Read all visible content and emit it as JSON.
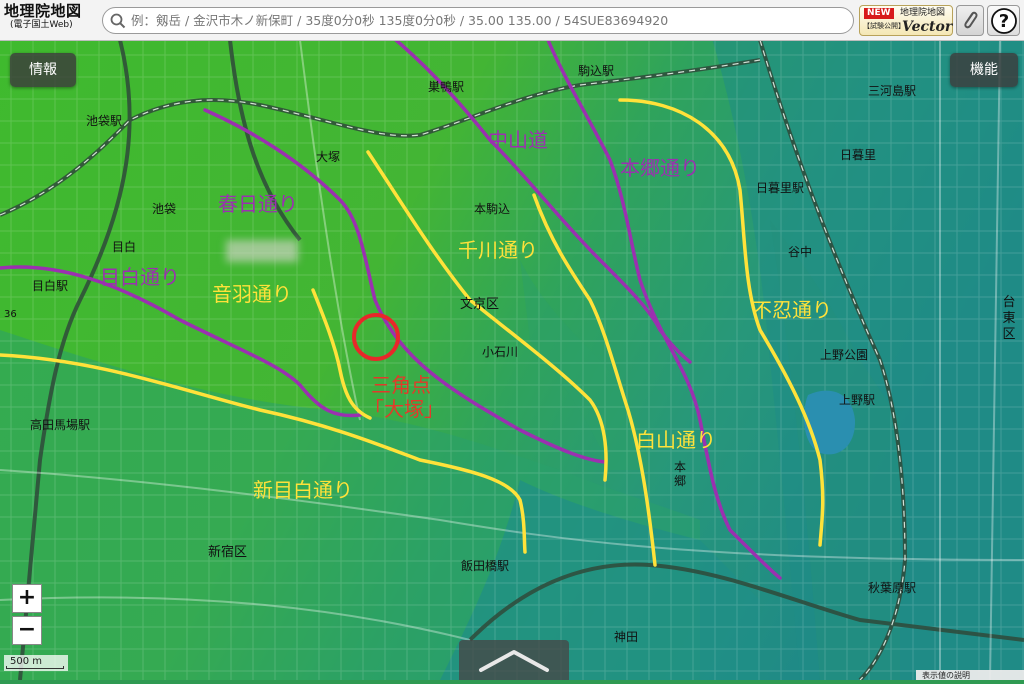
{
  "header": {
    "logo_title": "地理院地図",
    "logo_subtitle": "(電子国土Web)",
    "search_placeholder": "例：剱岳 / 金沢市木ノ新保町 / 35度0分0秒 135度0分0秒 / 35.00 135.00 / 54SUE83694920",
    "vector_badge_new": "NEW",
    "vector_badge_trial": "【試験公開】",
    "vector_badge_title": "地理院地図",
    "vector_badge_en": "Vector"
  },
  "buttons": {
    "info": "情報",
    "functions": "機能",
    "zoom_in": "+",
    "zoom_out": "−"
  },
  "scale_label": "500 m",
  "bottom_right_text": "表示値の説明",
  "map_labels": {
    "ikebukuro_station": "池袋駅",
    "ikebukuro": "池袋",
    "mejiro_station": "目白駅",
    "mejiro": "目白",
    "num36": "36",
    "otsuka": "大塚",
    "sugamo_station": "巣鴨駅",
    "komagome_station": "駒込駅",
    "honkomagome": "本駒込",
    "bunkyo": "文京区",
    "koishikawa": "小石川",
    "mikawashima_station": "三河島駅",
    "nippori": "日暮里",
    "nishinippori_station": "日暮里駅",
    "yanaka": "谷中",
    "ueno_park": "上野公園",
    "ueno_station": "上野駅",
    "taito": "台東区",
    "takadanobaba_station": "高田馬場駅",
    "shinjuku": "新宿区",
    "iidabashi_station": "飯田橋駅",
    "hongo": "本郷",
    "kanda": "神田",
    "akihabara_station": "秋葉原駅"
  },
  "road_labels": {
    "nakasendo": "中山道",
    "hongo_dori": "本郷通り",
    "kasuga_dori": "春日通り",
    "mejiro_dori": "目白通り",
    "otowa_dori": "音羽通り",
    "senkawa_dori": "千川通り",
    "shinobazu_dori": "不忍通り",
    "hakusan_dori": "白山通り",
    "shinmejiro_dori": "新目白通り"
  },
  "annotation": {
    "line1": "三角点",
    "line2": "「大塚」"
  },
  "colors": {
    "road_purple": "#9b30b0",
    "road_yellow": "#ffe23a",
    "marker_red": "#e8282a",
    "terrain_high": "#4cc42e",
    "terrain_low": "#1f8d86"
  }
}
